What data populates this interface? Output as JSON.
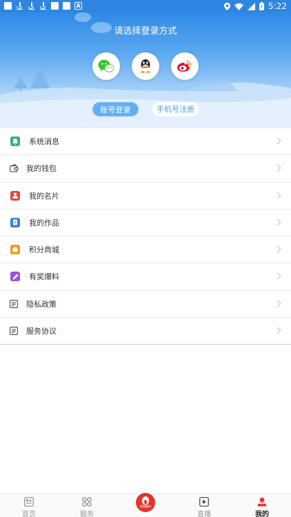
{
  "status_bar": {
    "time": "5:22"
  },
  "header": {
    "title": "请选择登录方式",
    "social_logins": [
      "wechat-icon",
      "qq-icon",
      "weibo-icon"
    ],
    "account_login_label": "账号登录",
    "phone_register_label": "手机号注册"
  },
  "menu": {
    "items": [
      {
        "label": "系统消息",
        "icon": "system-message-icon",
        "color": "#2bb673"
      },
      {
        "label": "我的钱包",
        "icon": "wallet-icon",
        "color": "#555555"
      },
      {
        "label": "我的名片",
        "icon": "business-card-icon",
        "color": "#e8453c"
      },
      {
        "label": "我的作品",
        "icon": "my-works-icon",
        "color": "#3c7ee0"
      },
      {
        "label": "积分商城",
        "icon": "points-mall-icon",
        "color": "#f39a1b"
      },
      {
        "label": "有奖爆料",
        "icon": "reward-tipoff-icon",
        "color": "#9b4fe0"
      },
      {
        "label": "隐私政策",
        "icon": "privacy-policy-icon",
        "color": "#555555"
      },
      {
        "label": "服务协议",
        "icon": "service-agreement-icon",
        "color": "#555555"
      }
    ]
  },
  "tabbar": {
    "tabs": [
      {
        "label": "首页",
        "icon": "home-icon"
      },
      {
        "label": "服务",
        "icon": "services-icon"
      },
      {
        "label": "",
        "icon": "center-action-icon"
      },
      {
        "label": "直播",
        "icon": "live-icon"
      },
      {
        "label": "我的",
        "icon": "profile-icon"
      }
    ],
    "center_label": "投稿爆料",
    "active_color": "#e8322c"
  }
}
